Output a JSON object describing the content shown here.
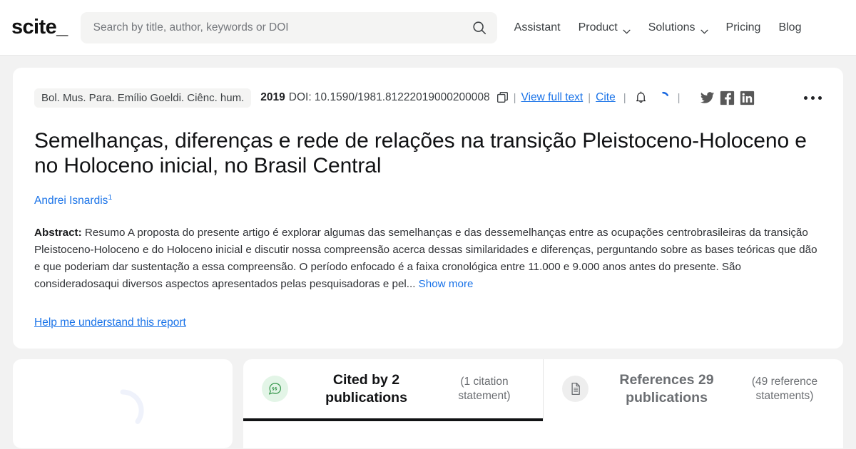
{
  "nav": {
    "logo": "scite_",
    "search": {
      "placeholder": "Search by title, author, keywords or DOI",
      "value": "",
      "icon": "search-icon"
    },
    "links": [
      {
        "label": "Assistant",
        "has_caret": false
      },
      {
        "label": "Product",
        "has_caret": true
      },
      {
        "label": "Solutions",
        "has_caret": true
      },
      {
        "label": "Pricing",
        "has_caret": false
      },
      {
        "label": "Blog",
        "has_caret": false
      }
    ]
  },
  "paper": {
    "journal": "Bol. Mus. Para. Emílio Goeldi. Ciênc. hum.",
    "year": "2019",
    "doi": "DOI: 10.1590/1981.81222019000200008",
    "copy_icon": "copy-icon",
    "sep": "|",
    "view_full_text": "View full text",
    "cite": "Cite",
    "bell_icon": "notification-bell-icon",
    "spinner_icon": "loading-spinner",
    "socials": [
      {
        "name": "twitter-icon"
      },
      {
        "name": "facebook-icon"
      },
      {
        "name": "linkedin-icon"
      }
    ],
    "more_menu": "more-options-icon",
    "title": "Semelhanças, diferenças e rede de relações na transição Pleistoceno-Holoceno e no Holoceno inicial, no Brasil Central",
    "authors": [
      {
        "name": "Andrei Isnardis",
        "affiliation": "1"
      }
    ],
    "abstract_label": "Abstract:",
    "abstract_text": " Resumo A proposta do presente artigo é explorar algumas das semelhanças e das dessemelhanças entre as ocupações centrobrasileiras da transição Pleistoceno-Holoceno e do Holoceno inicial e discutir nossa compreensão acerca dessas similaridades e diferenças, perguntando sobre as bases teóricas que dão e que poderiam dar sustentação a essa compreensão. O período enfocado é a faixa cronológica entre 11.000 e 9.000 anos antes do presente. São consideradosaqui diversos aspectos apresentados pelas pesquisadoras e pel... ",
    "show_more": "Show more",
    "help_link": "Help me understand this report"
  },
  "bottom": {
    "loading_spinner": "loading-spinner",
    "tabs": [
      {
        "icon": "citation-bubble-icon",
        "title": "Cited by 2 publications",
        "subtitle": "(1 citation statement)",
        "active": true
      },
      {
        "icon": "document-references-icon",
        "title": "References 29 publications",
        "subtitle": "(49 reference statements)",
        "active": false
      }
    ]
  },
  "colors": {
    "accent_blue": "#1a73e8",
    "page_bg": "#f2f2f2",
    "card_bg": "#ffffff",
    "active_tab_underline": "#111214",
    "cited_icon_green": "#3f9c54",
    "social_icon_gray": "#585858"
  }
}
